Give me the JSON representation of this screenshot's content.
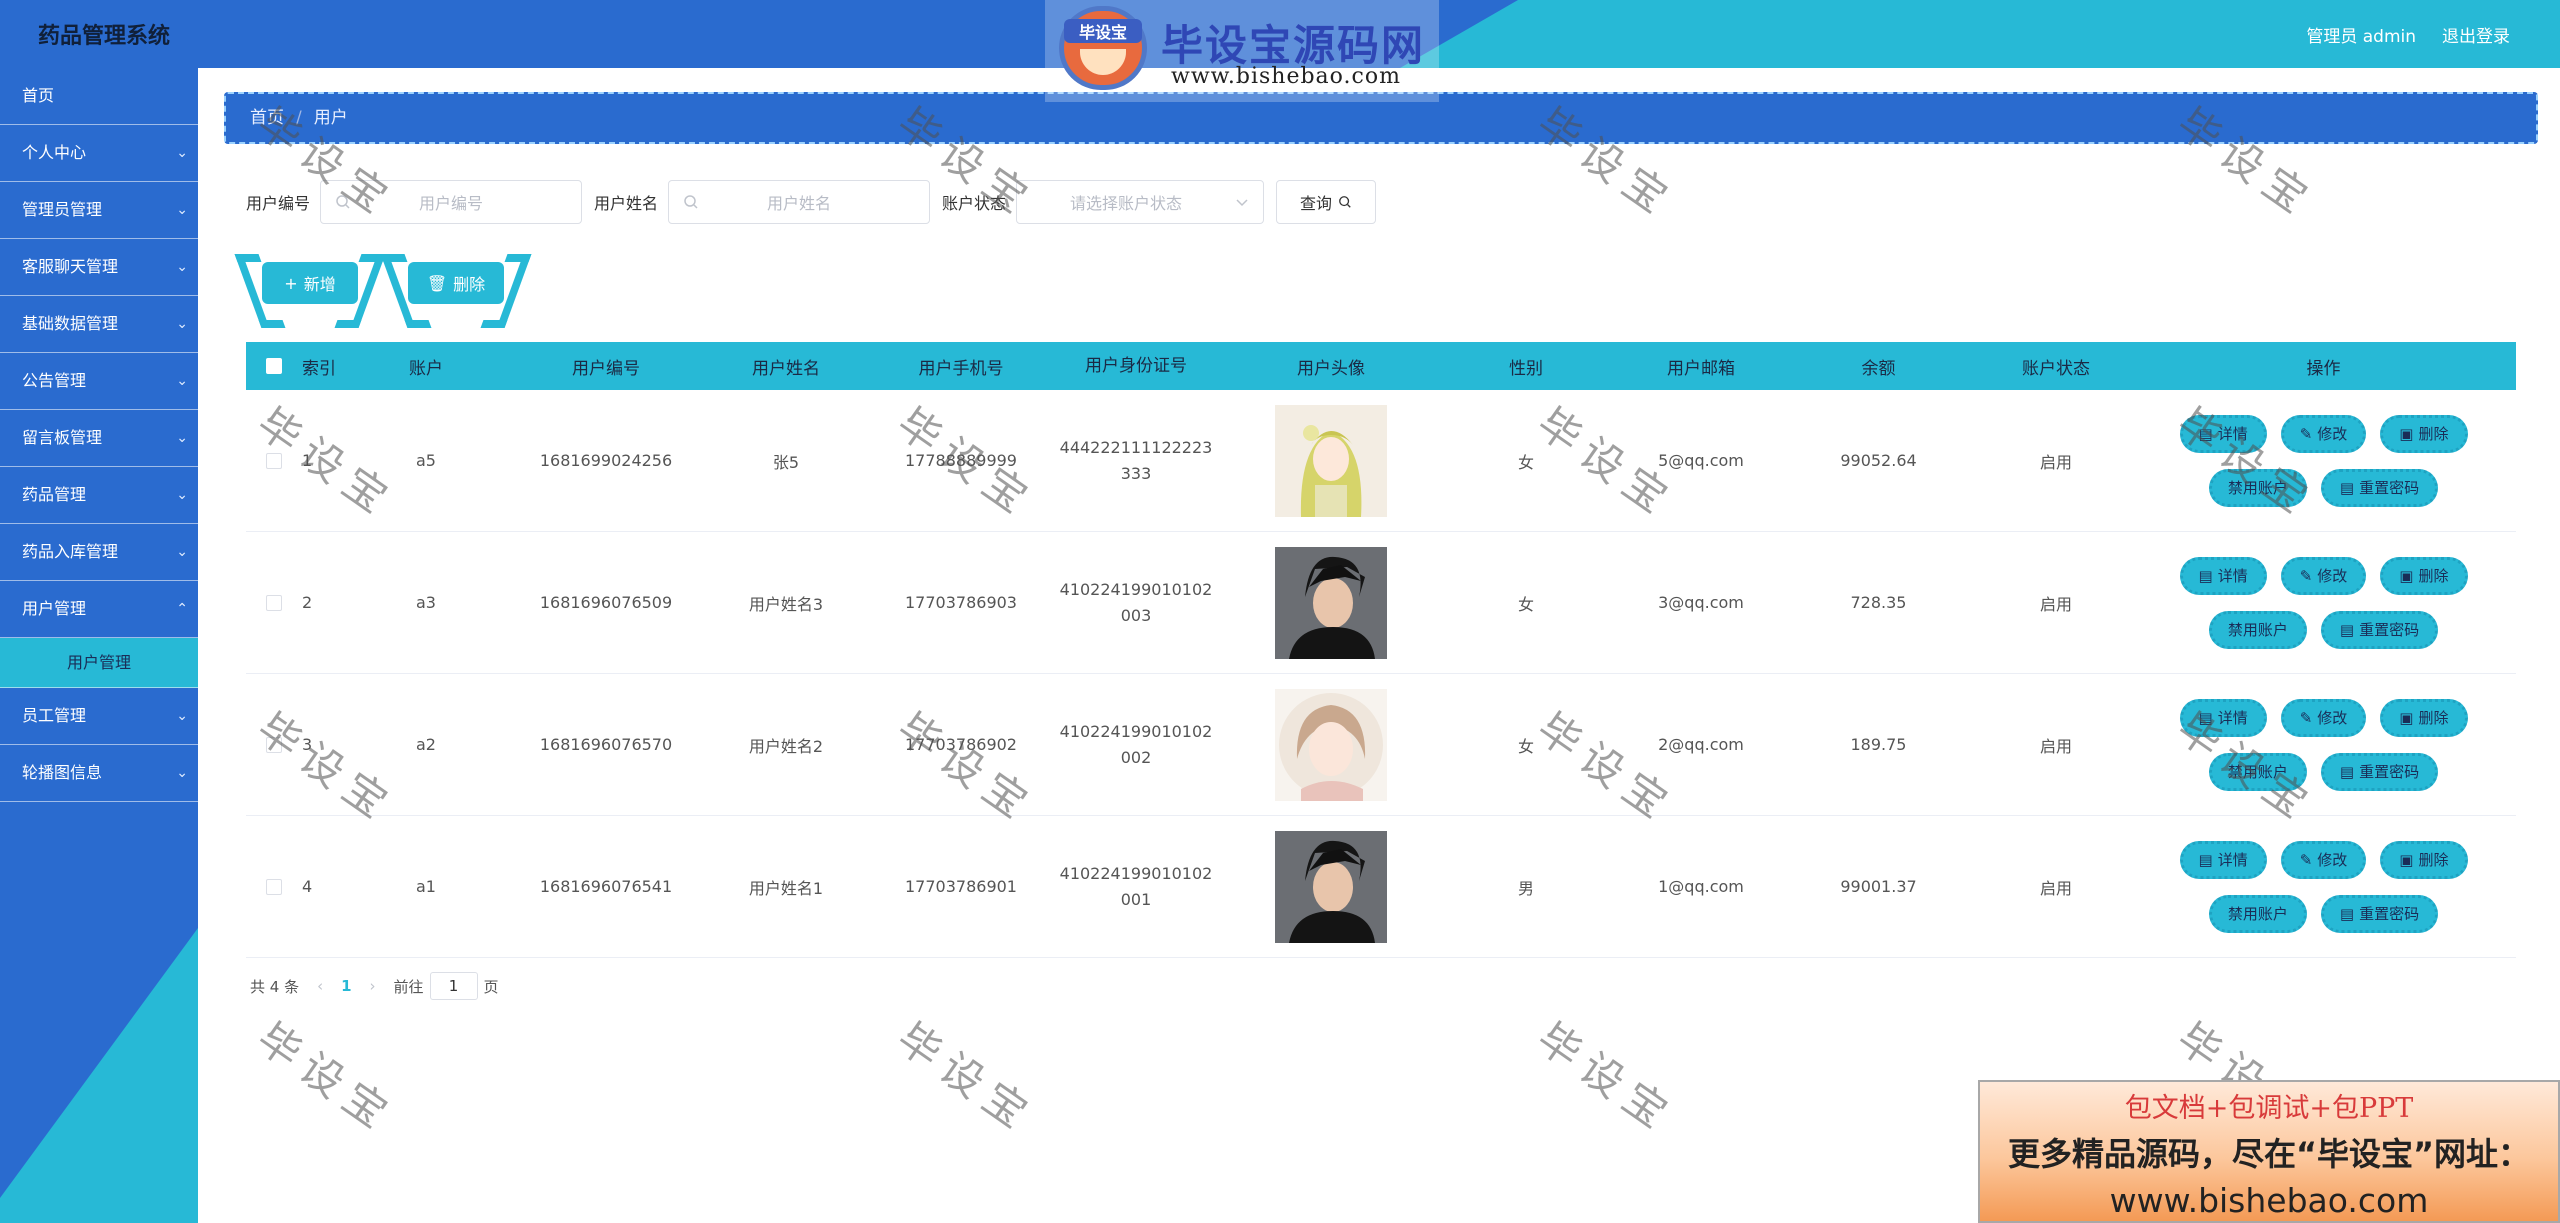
{
  "header": {
    "app_title": "药品管理系统",
    "user_label": "管理员 admin",
    "logout_label": "退出登录"
  },
  "logo": {
    "badge": "毕设宝",
    "title": "毕设宝源码网",
    "url": "www.bishebao.com"
  },
  "sidebar": {
    "items": [
      {
        "label": "首页"
      },
      {
        "label": "个人中心"
      },
      {
        "label": "管理员管理"
      },
      {
        "label": "客服聊天管理"
      },
      {
        "label": "基础数据管理"
      },
      {
        "label": "公告管理"
      },
      {
        "label": "留言板管理"
      },
      {
        "label": "药品管理"
      },
      {
        "label": "药品入库管理"
      },
      {
        "label": "用户管理"
      },
      {
        "label": "员工管理"
      },
      {
        "label": "轮播图信息"
      }
    ],
    "active_sub": "用户管理"
  },
  "breadcrumb": {
    "home": "首页",
    "current": "用户"
  },
  "search": {
    "user_no_label": "用户编号",
    "user_no_placeholder": "用户编号",
    "user_name_label": "用户姓名",
    "user_name_placeholder": "用户姓名",
    "status_label": "账户状态",
    "status_placeholder": "请选择账户状态",
    "query_label": "查询"
  },
  "actions": {
    "add_label": "新增",
    "delete_label": "删除"
  },
  "table": {
    "headers": [
      "索引",
      "账户",
      "用户编号",
      "用户姓名",
      "用户手机号",
      "用户身份证号",
      "用户头像",
      "性别",
      "用户邮箱",
      "余额",
      "账户状态",
      "操作"
    ],
    "rows": [
      {
        "index": "1",
        "account": "a5",
        "user_no": "1681699024256",
        "name": "张5",
        "phone": "17788889999",
        "id_card": "444222111122223333",
        "sex": "女",
        "email": "5@qq.com",
        "balance": "99052.64",
        "status": "启用"
      },
      {
        "index": "2",
        "account": "a3",
        "user_no": "1681696076509",
        "name": "用户姓名3",
        "phone": "17703786903",
        "id_card": "410224199010102003",
        "sex": "女",
        "email": "3@qq.com",
        "balance": "728.35",
        "status": "启用"
      },
      {
        "index": "3",
        "account": "a2",
        "user_no": "1681696076570",
        "name": "用户姓名2",
        "phone": "17703786902",
        "id_card": "410224199010102002",
        "sex": "女",
        "email": "2@qq.com",
        "balance": "189.75",
        "status": "启用"
      },
      {
        "index": "4",
        "account": "a1",
        "user_no": "1681696076541",
        "name": "用户姓名1",
        "phone": "17703786901",
        "id_card": "410224199010102001",
        "sex": "男",
        "email": "1@qq.com",
        "balance": "99001.37",
        "status": "启用"
      }
    ],
    "ops": {
      "detail": "详情",
      "edit": "修改",
      "delete": "删除",
      "disable": "禁用账户",
      "reset": "重置密码"
    }
  },
  "pager": {
    "total": "共 4 条",
    "current_page": "1",
    "goto_label": "前往",
    "goto_value": "1",
    "page_suffix": "页"
  },
  "watermark": "毕设宝",
  "promo": {
    "line1": "包文档+包调试+包PPT",
    "line2": "更多精品源码，尽在“毕设宝”网址：",
    "line3": "www.bishebao.com"
  }
}
